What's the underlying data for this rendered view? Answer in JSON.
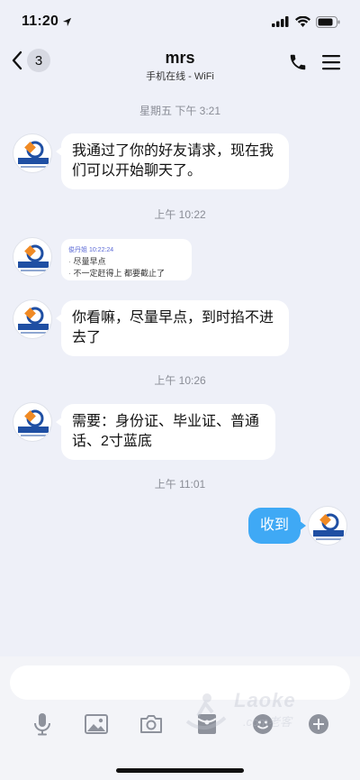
{
  "status_bar": {
    "time": "11:20"
  },
  "nav": {
    "back_count": "3",
    "title": "mrs",
    "subtitle": "手机在线 - WiFi"
  },
  "messages": [
    {
      "type": "time",
      "text": "星期五 下午 3:21"
    },
    {
      "type": "incoming",
      "text": "我通过了你的好友请求，现在我们可以开始聊天了。"
    },
    {
      "type": "time",
      "text": "上午 10:22"
    },
    {
      "type": "quote",
      "head": "俊丹姐  10:22:24",
      "lines": [
        "尽量早点",
        "不一定赶得上 都要截止了"
      ]
    },
    {
      "type": "incoming",
      "text": "你看嘛，尽量早点，到时掐不进去了"
    },
    {
      "type": "time",
      "text": "上午 10:26"
    },
    {
      "type": "incoming",
      "text": "需要：身份证、毕业证、普通话、2寸蓝底"
    },
    {
      "type": "time",
      "text": "上午 11:01"
    },
    {
      "type": "outgoing",
      "text": "收到"
    }
  ],
  "avatar": {
    "brand": "建程教育",
    "sub": "JIANCHENGEDU"
  },
  "input": {
    "placeholder": ""
  },
  "watermark": {
    "text": "Laoke",
    "sub": ".com老客"
  },
  "colors": {
    "accent": "#3fa9f5",
    "background": "#eef0f8",
    "logo_blue": "#1f4fa3",
    "logo_orange": "#f08a24"
  }
}
